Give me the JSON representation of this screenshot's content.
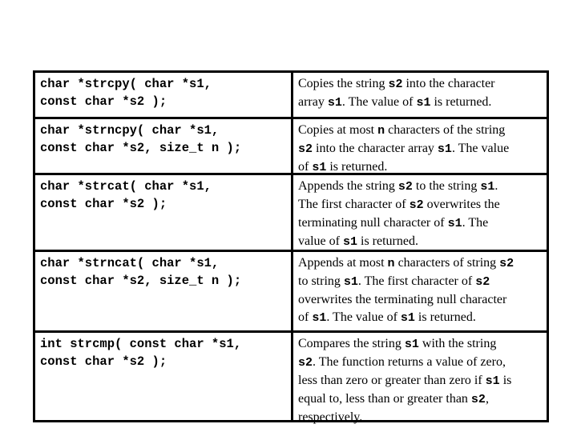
{
  "table": {
    "rows": [
      {
        "signature": [
          "char *strcpy( char *s1,",
          "const char *s2 );"
        ],
        "description": [
          [
            {
              "t": "Copies the string "
            },
            {
              "c": "s2"
            },
            {
              "t": " into the character"
            }
          ],
          [
            {
              "t": "array "
            },
            {
              "c": "s1"
            },
            {
              "t": ". The value of "
            },
            {
              "c": "s1"
            },
            {
              "t": " is returned."
            }
          ]
        ]
      },
      {
        "signature": [
          "char *strncpy( char *s1,",
          "const char *s2, size_t n );"
        ],
        "description": [
          [
            {
              "t": "Copies at most "
            },
            {
              "c": "n"
            },
            {
              "t": " characters of the string"
            }
          ],
          [
            {
              "c": "s2"
            },
            {
              "t": " into the character array "
            },
            {
              "c": "s1"
            },
            {
              "t": ". The value"
            }
          ],
          [
            {
              "t": "of "
            },
            {
              "c": "s1"
            },
            {
              "t": " is returned."
            }
          ]
        ]
      },
      {
        "signature": [
          "char *strcat( char *s1,",
          "const char *s2 );"
        ],
        "description": [
          [
            {
              "t": "Appends the string "
            },
            {
              "c": "s2"
            },
            {
              "t": " to the string "
            },
            {
              "c": "s1"
            },
            {
              "t": "."
            }
          ],
          [
            {
              "t": "The first character of "
            },
            {
              "c": "s2"
            },
            {
              "t": " overwrites the"
            }
          ],
          [
            {
              "t": "terminating null character of "
            },
            {
              "c": "s1"
            },
            {
              "t": ". The"
            }
          ],
          [
            {
              "t": "value of "
            },
            {
              "c": "s1"
            },
            {
              "t": " is returned."
            }
          ]
        ]
      },
      {
        "signature": [
          "char *strncat( char *s1,",
          "const char *s2, size_t n );"
        ],
        "description": [
          [
            {
              "t": "Appends at most "
            },
            {
              "c": "n"
            },
            {
              "t": " characters of string "
            },
            {
              "c": "s2"
            }
          ],
          [
            {
              "t": "to string "
            },
            {
              "c": "s1"
            },
            {
              "t": ". The first character of "
            },
            {
              "c": "s2"
            }
          ],
          [
            {
              "t": "overwrites the terminating null character"
            }
          ],
          [
            {
              "t": "of "
            },
            {
              "c": "s1"
            },
            {
              "t": ". The value of "
            },
            {
              "c": "s1"
            },
            {
              "t": " is returned."
            }
          ]
        ]
      },
      {
        "signature": [
          "int strcmp( const char *s1,",
          "const char *s2 );"
        ],
        "description": [
          [
            {
              "t": "Compares the string "
            },
            {
              "c": "s1"
            },
            {
              "t": " with the string"
            }
          ],
          [
            {
              "c": "s2"
            },
            {
              "t": ". The function returns a value of zero,"
            }
          ],
          [
            {
              "t": "less than zero or greater than zero if "
            },
            {
              "c": "s1"
            },
            {
              "t": " is"
            }
          ],
          [
            {
              "t": "equal to, less than or greater than "
            },
            {
              "c": "s2"
            },
            {
              "t": ","
            }
          ],
          [
            {
              "t": "respectively."
            }
          ]
        ]
      }
    ]
  }
}
